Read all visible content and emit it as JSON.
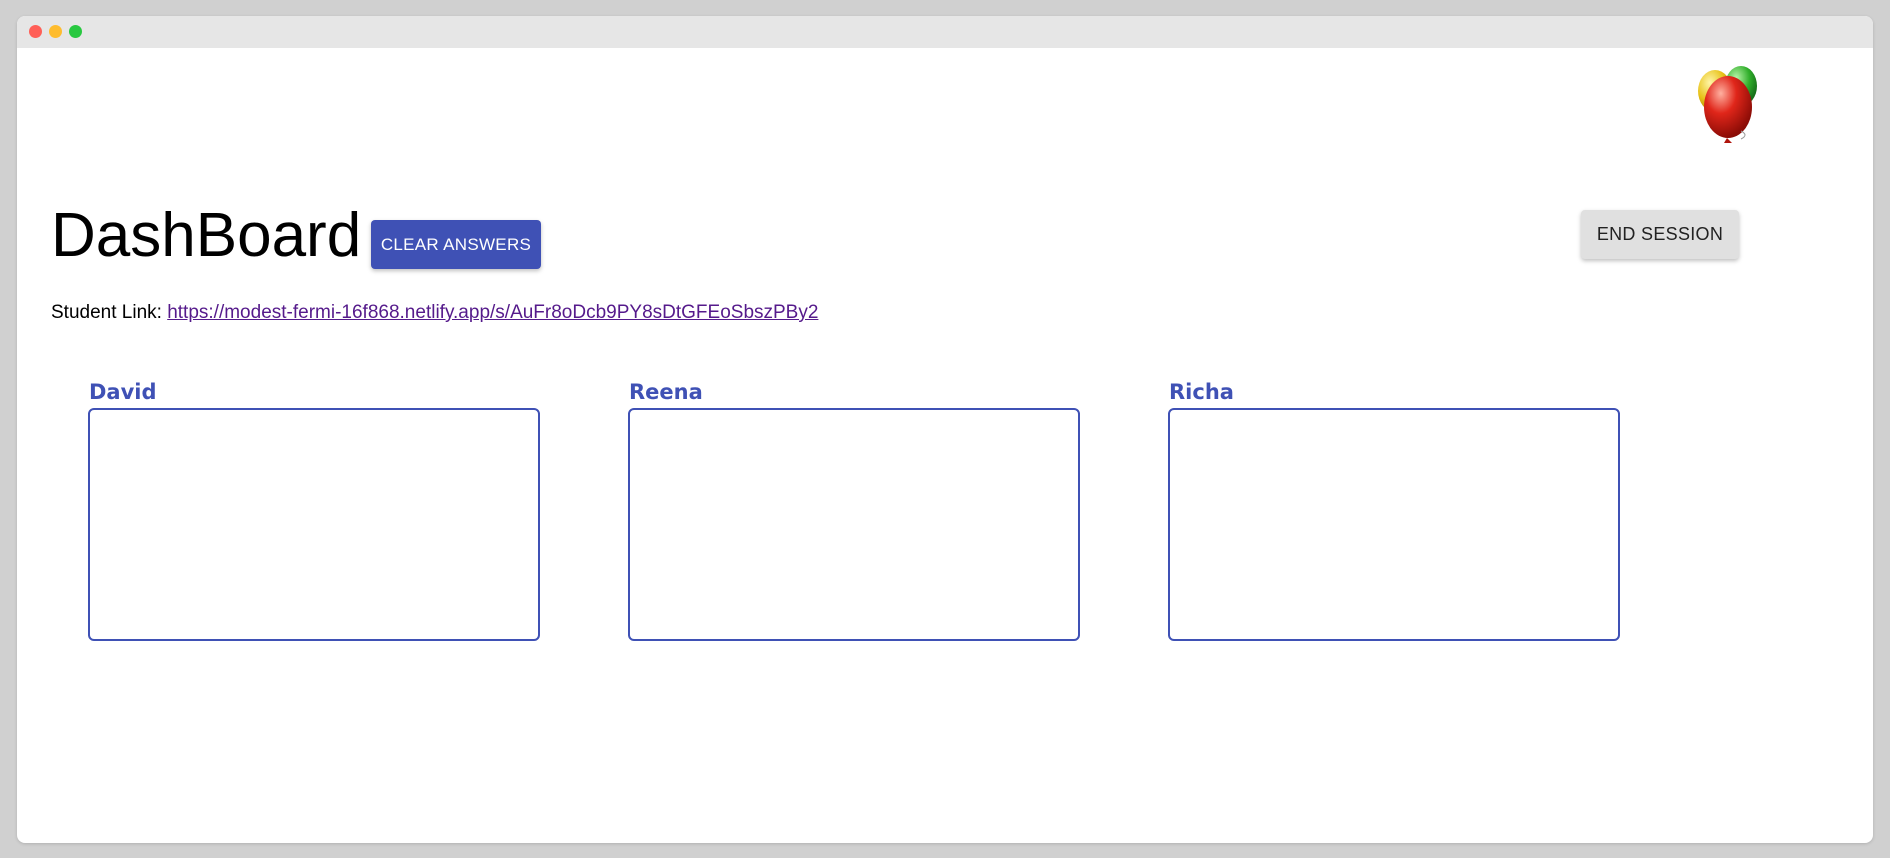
{
  "window": {
    "title": ""
  },
  "colors": {
    "primary": "#3f51b5",
    "link_visited": "#551a8b",
    "end_button_bg": "#e0e0e0"
  },
  "header": {
    "title": "DashBoard",
    "clear_answers_label": "CLEAR ANSWERS",
    "end_session_label": "END SESSION",
    "decoration_icon": "balloons-icon"
  },
  "student_link": {
    "label": "Student Link:",
    "url": "https://modest-fermi-16f868.netlify.app/s/AuFr8oDcb9PY8sDtGFEoSbszPBy2"
  },
  "students": [
    {
      "name": "David",
      "answer": ""
    },
    {
      "name": "Reena",
      "answer": ""
    },
    {
      "name": "Richa",
      "answer": ""
    }
  ]
}
